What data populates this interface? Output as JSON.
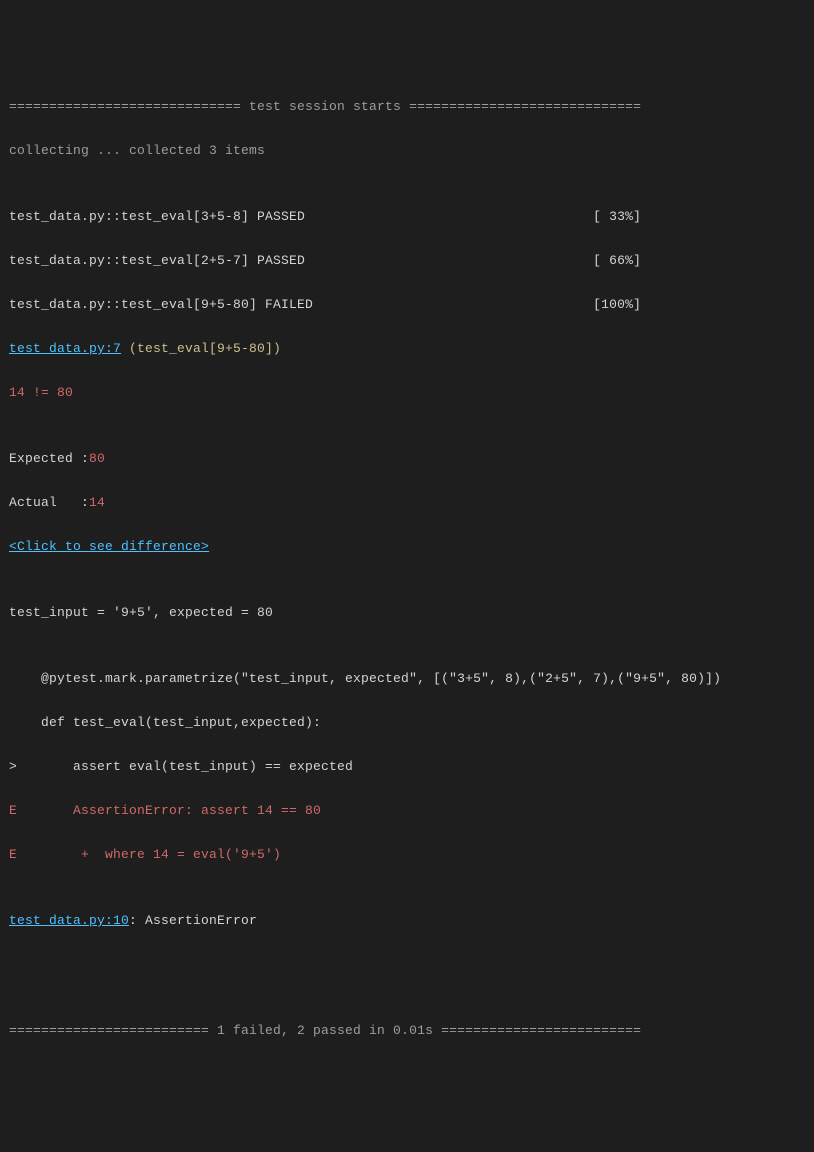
{
  "session": {
    "header": "============================= test session starts =============================",
    "collecting": "collecting ... collected 3 items"
  },
  "results": [
    {
      "name": "test_data.py::test_eval[3+5-8] PASSED                                    [ 33%]"
    },
    {
      "name": "test_data.py::test_eval[2+5-7] PASSED                                    [ 66%]"
    },
    {
      "name": "test_data.py::test_eval[9+5-80] FAILED                                   [100%]"
    }
  ],
  "failure": {
    "location_link": "test_data.py:7",
    "location_suffix": " (test_eval[9+5-80])",
    "assertion_msg": "14 != 80",
    "expected_label": "Expected :",
    "expected_value": "80",
    "actual_label": "Actual   :",
    "actual_value": "14",
    "diff_link": "<Click to see difference>",
    "params_line": "test_input = '9+5', expected = 80",
    "code": {
      "l1": "    @pytest.mark.parametrize(\"test_input, expected\", [(\"3+5\", 8),(\"2+5\", 7),(\"9+5\", 80)])",
      "l2": "    def test_eval(test_input,expected):",
      "l3": ">       assert eval(test_input) == expected",
      "l4": "E       AssertionError: assert 14 == 80",
      "l5": "E        +  where 14 = eval('9+5')"
    },
    "bottom_link": "test_data.py:10",
    "bottom_suffix": ": AssertionError"
  },
  "summary": "========================= 1 failed, 2 passed in 0.01s =========================",
  "blank": ""
}
